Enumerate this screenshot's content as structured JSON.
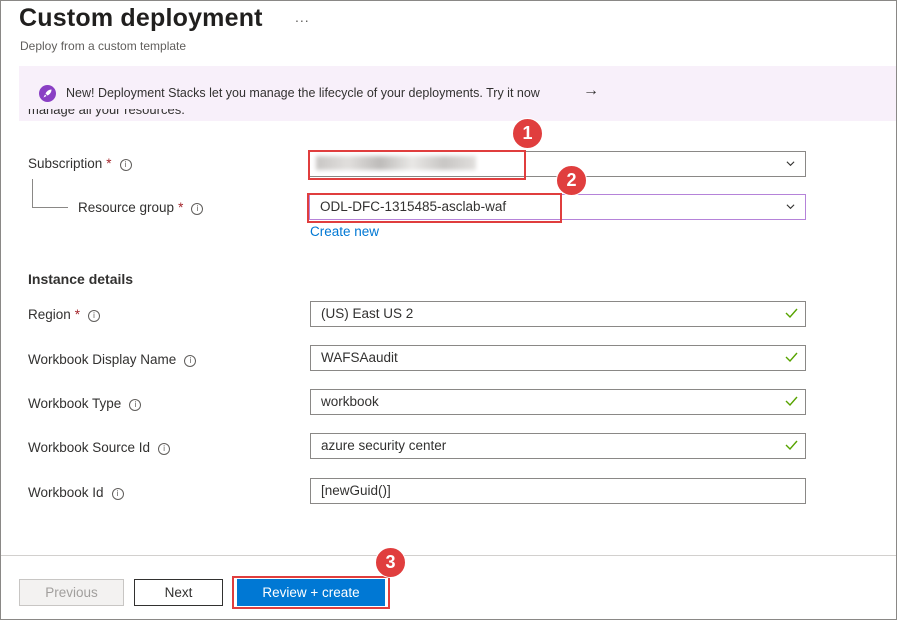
{
  "header": {
    "title": "Custom deployment",
    "more_label": "...",
    "subtitle": "Deploy from a custom template"
  },
  "banner": {
    "icon": "rocket-icon",
    "text": "New! Deployment Stacks let you manage the lifecycle of your deployments. Try it now",
    "arrow": "→"
  },
  "cutoff_text": "manage all your resources.",
  "project": {
    "subscription_label": "Subscription",
    "subscription_value": "",
    "resource_group_label": "Resource group",
    "resource_group_value": "ODL-DFC-1315485-asclab-waf",
    "create_new_link": "Create new",
    "required_mark": "*",
    "info_glyph": "i"
  },
  "instance": {
    "section_title": "Instance details",
    "fields": [
      {
        "label": "Region",
        "value": "(US) East US 2",
        "required": true
      },
      {
        "label": "Workbook Display Name",
        "value": "WAFSAaudit"
      },
      {
        "label": "Workbook Type",
        "value": "workbook"
      },
      {
        "label": "Workbook Source Id",
        "value": "azure security center"
      },
      {
        "label": "Workbook Id",
        "value": "[newGuid()]"
      }
    ]
  },
  "callouts": [
    "1",
    "2",
    "3"
  ],
  "footer": {
    "previous_label": "Previous",
    "next_label": "Next",
    "review_label": "Review + create"
  },
  "colors": {
    "accent": "#0078d4",
    "callout": "#e03e3e",
    "required": "#a4262c",
    "valid": "#57a300",
    "banner_bg": "#f8f0fa"
  }
}
